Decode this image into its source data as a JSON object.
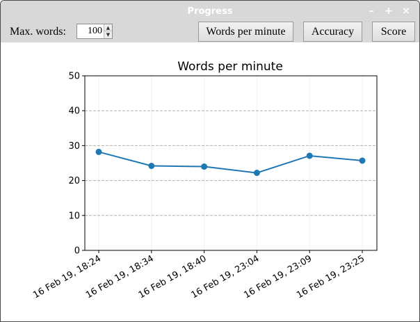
{
  "window": {
    "title": "Progress",
    "minimize_glyph": "–",
    "maximize_glyph": "+",
    "close_glyph": "×"
  },
  "toolbar": {
    "max_words_label": "Max. words:",
    "max_words_value": "100",
    "buttons": {
      "wpm": "Words per minute",
      "accuracy": "Accuracy",
      "score": "Score"
    }
  },
  "icons": {
    "spin_up": "chevron-up-icon",
    "spin_down": "chevron-down-icon"
  },
  "colors": {
    "line": "#1f77b4",
    "grid": "#b0b0b0",
    "chrome": "#d8d8d8"
  },
  "chart_data": {
    "type": "line",
    "title": "Words per minute",
    "xlabel": "",
    "ylabel": "",
    "categories": [
      "16 Feb 19, 18:24",
      "16 Feb 19, 18:34",
      "16 Feb 19, 18:40",
      "16 Feb 19, 23:04",
      "16 Feb 19, 23:09",
      "16 Feb 19, 23:25"
    ],
    "values": [
      28.2,
      24.2,
      24.0,
      22.2,
      27.1,
      25.7
    ],
    "ylim": [
      0,
      50
    ],
    "yticks": [
      0,
      10,
      20,
      30,
      40,
      50
    ],
    "grid": "horizontal dashed",
    "legend": "none"
  }
}
